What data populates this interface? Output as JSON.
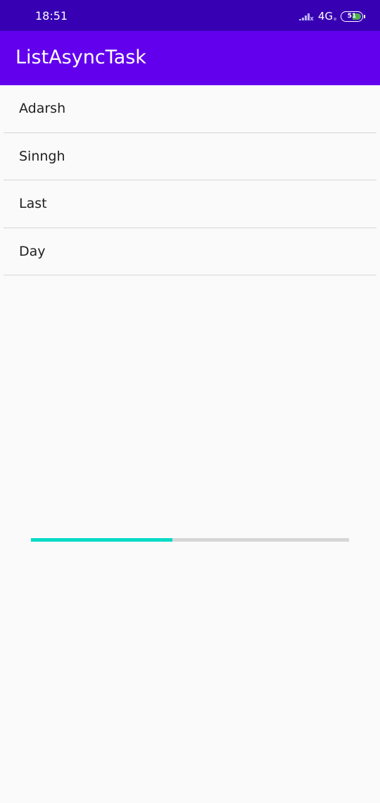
{
  "status_bar": {
    "time": "18:51",
    "network": "4G",
    "network_sub": "ıı",
    "battery_level": "51",
    "battery_color": "#4caf50",
    "icons": [
      "signal-icon",
      "battery-icon"
    ]
  },
  "app_bar": {
    "title": "ListAsyncTask",
    "color": "#6200ee"
  },
  "list": {
    "items": [
      {
        "label": "Adarsh"
      },
      {
        "label": "Sinngh"
      },
      {
        "label": "Last"
      },
      {
        "label": "Day"
      }
    ]
  },
  "progress": {
    "fraction": 0.445,
    "fill_color": "#03dac5",
    "track_color": "#d6d6d6"
  }
}
